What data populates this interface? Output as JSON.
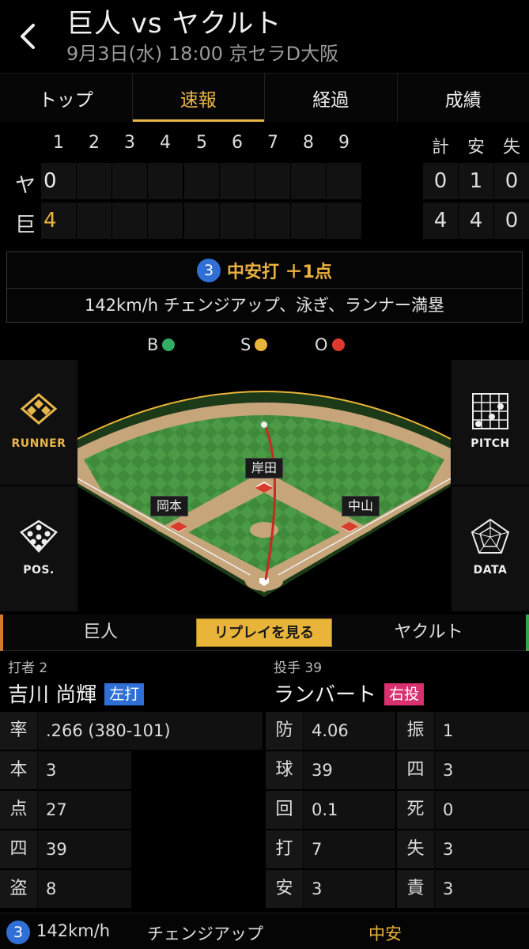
{
  "header": {
    "title": "巨人 vs ヤクルト",
    "subtitle": "9月3日(水) 18:00 京セラD大阪"
  },
  "tabs": [
    {
      "label": "トップ",
      "active": false
    },
    {
      "label": "速報",
      "active": true
    },
    {
      "label": "経過",
      "active": false
    },
    {
      "label": "成績",
      "active": false
    }
  ],
  "scoreboard": {
    "innings": [
      "1",
      "2",
      "3",
      "4",
      "5",
      "6",
      "7",
      "8",
      "9"
    ],
    "totals_headers": [
      "計",
      "安",
      "失"
    ],
    "teams": [
      {
        "abbr": "ヤ",
        "innings": [
          "0",
          "",
          "",
          "",
          "",
          "",
          "",
          "",
          ""
        ],
        "totals": [
          "0",
          "1",
          "0"
        ]
      },
      {
        "abbr": "巨",
        "innings": [
          "4",
          "",
          "",
          "",
          "",
          "",
          "",
          "",
          ""
        ],
        "totals": [
          "4",
          "4",
          "0"
        ]
      }
    ]
  },
  "play": {
    "number": "3",
    "title": "中安打 ＋1点",
    "description": "142km/h チェンジアップ、泳ぎ、ランナー満塁"
  },
  "count": {
    "b_label": "B",
    "s_label": "S",
    "o_label": "O",
    "b_color": "#2fae64",
    "s_color": "#e9b43a",
    "o_color": "#e0382e"
  },
  "field": {
    "fielders": [
      "岸田",
      "岡本",
      "中山"
    ]
  },
  "side_buttons": {
    "runner": "RUNNER",
    "pitch": "PITCH",
    "pos": "POS.",
    "data": "DATA"
  },
  "teambar": {
    "left": "巨人",
    "replay": "リプレイを見る",
    "right": "ヤクルト"
  },
  "batter": {
    "role": "打者 2",
    "name": "吉川 尚輝",
    "badge": "左打",
    "badge_color": "#2f6fd6",
    "stats": [
      {
        "k": "率",
        "v": ".266 (380-101)"
      },
      {
        "k": "本",
        "v": "3"
      },
      {
        "k": "点",
        "v": "27"
      },
      {
        "k": "四",
        "v": "39"
      },
      {
        "k": "盗",
        "v": "8"
      }
    ]
  },
  "pitcher": {
    "role": "投手 39",
    "name": "ランバート",
    "badge": "右投",
    "badge_color": "#d8316e",
    "stats_left": [
      {
        "k": "防",
        "v": "4.06"
      },
      {
        "k": "球",
        "v": "39"
      },
      {
        "k": "回",
        "v": "0.1"
      },
      {
        "k": "打",
        "v": "7"
      },
      {
        "k": "安",
        "v": "3"
      }
    ],
    "stats_right": [
      {
        "k": "振",
        "v": "1"
      },
      {
        "k": "四",
        "v": "3"
      },
      {
        "k": "死",
        "v": "0"
      },
      {
        "k": "失",
        "v": "3"
      },
      {
        "k": "責",
        "v": "3"
      }
    ]
  },
  "bottom": {
    "number": "3",
    "speed": "142km/h",
    "pitch": "チェンジアップ",
    "result": "中安"
  }
}
